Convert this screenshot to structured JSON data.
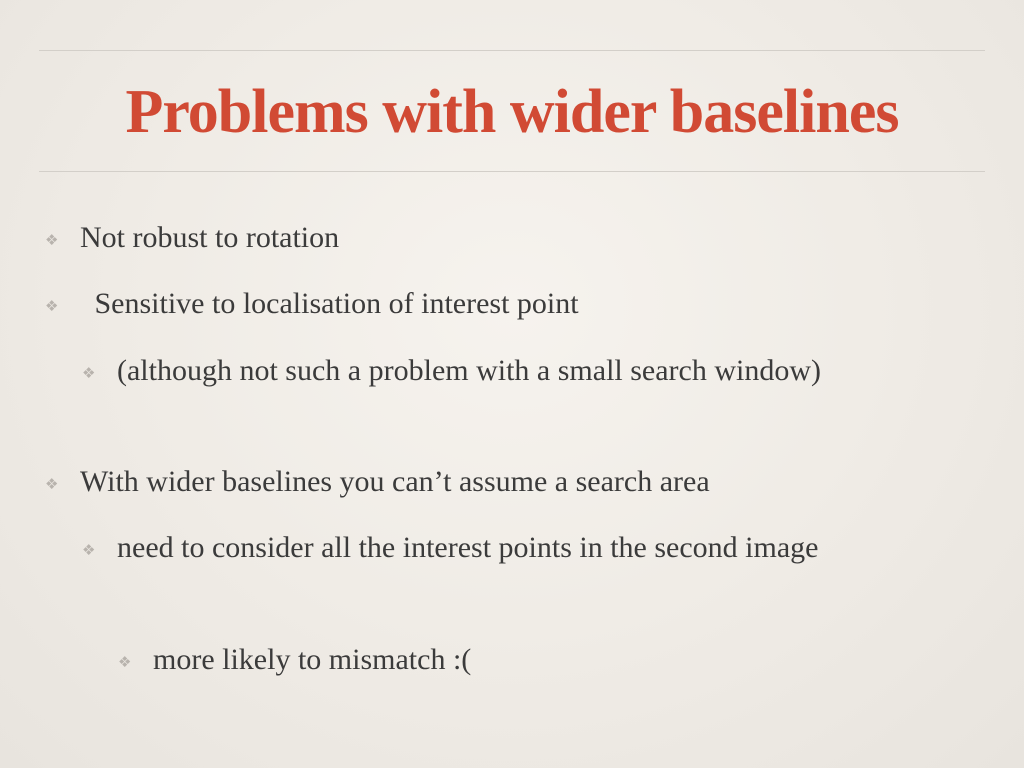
{
  "slide": {
    "title": "Problems with wider baselines",
    "bullet_marker": "❖",
    "bullets": [
      {
        "text": "Not robust to rotation",
        "level": 1
      },
      {
        "text": " Sensitive to localisation of interest point",
        "level": 1
      },
      {
        "text": "(although not such a problem with a small search window)",
        "level": 2
      },
      {
        "text": "With wider baselines you can’t assume a search area",
        "level": 1
      },
      {
        "text": "need to consider all the interest points in the second image",
        "level": 2
      },
      {
        "text": "more likely to mismatch :(",
        "level": 3
      }
    ]
  },
  "colors": {
    "title": "#d14a34",
    "body_text": "#3b3b3b",
    "marker": "#b8b3ad",
    "rule": "#d3cfc9",
    "background": "#f2efea"
  }
}
